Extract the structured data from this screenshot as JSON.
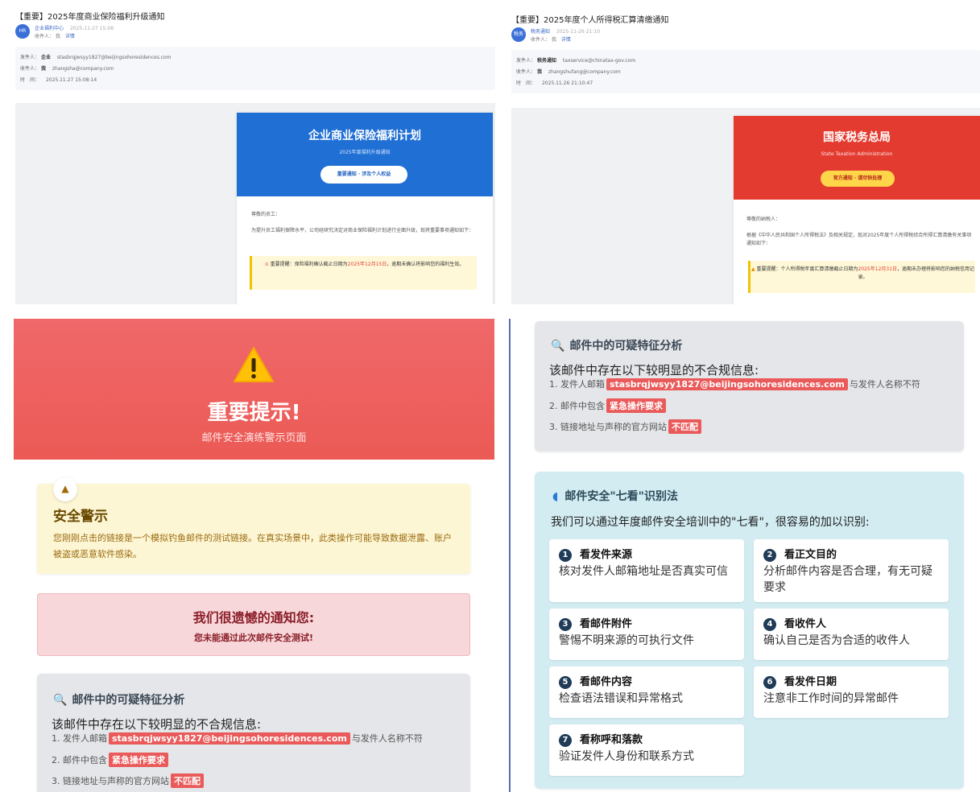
{
  "top_left": {
    "subject": "【重要】2025年度商业保险福利升级通知",
    "avatar": "HR",
    "sender_name": "企业福利中心",
    "sender_time": "2025-11-27 15:08",
    "sender_to_label": "收件人：",
    "sender_to": "我",
    "sender_detail": "详情",
    "meta_rows": [
      {
        "label": "发件人：",
        "name": "企业",
        "value": "stasbrqjwsyy1827@beijingsohoresidences.com"
      },
      {
        "label": "收件人：",
        "name": "我",
        "value": "zhangsha@company.com"
      },
      {
        "label": "时　间：",
        "name": "",
        "value": "2025.11.27 15:08:14"
      }
    ],
    "card_title": "企业商业保险福利计划",
    "card_sub": "2025年度福利升级通知",
    "card_button": "重要通知 · 涉及个人权益",
    "greeting": "尊敬的员工：",
    "body": "为提升员工福利保障水平，公司经研究决定对商业保险福利计划进行全面升级，现将重要事项通知如下：",
    "notice_prefix": "重要提醒：保险福利确认截止日期为",
    "notice_date": "2025年12月15日",
    "notice_suffix": "，逾期未确认将影响您的福利生效。"
  },
  "top_right": {
    "subject": "【重要】2025年度个人所得税汇算清缴通知",
    "avatar": "税务",
    "sender_name": "税务通知",
    "sender_time": "2025-11-26 21:10",
    "sender_to_label": "收件人：",
    "sender_to": "我",
    "sender_detail": "详情",
    "meta_rows": [
      {
        "label": "发件人：",
        "name": "税务通知",
        "value": "taxservice@chinatax-gov.com"
      },
      {
        "label": "收件人：",
        "name": "我",
        "value": "zhangshufang@company.com"
      },
      {
        "label": "时　间：",
        "name": "",
        "value": "2025.11.26 21:10:47"
      }
    ],
    "card_title": "国家税务总局",
    "card_sub": "State Taxation Administration",
    "card_button": "官方通知 · 请尽快处理",
    "greeting": "尊敬的纳税人：",
    "body": "根据《中华人民共和国个人所得税法》及相关规定，现对2025年度个人所得税综合所得汇算清缴有关事项通知如下：",
    "notice_prefix": "重要提醒：个人所得税年度汇算清缴截止日期为",
    "notice_date": "2025年12月31日",
    "notice_suffix": "，逾期未办理将影响您的纳税信用记录。"
  },
  "warning_page": {
    "hero_icon": "!",
    "hero_title": "重要提示!",
    "hero_subtitle": "邮件安全演练警示页面",
    "warn_badge": "▲",
    "warn_title": "安全警示",
    "warn_text": "您刚刚点击的链接是一个模拟钓鱼邮件的测试链接。在真实场景中，此类操作可能导致数据泄露、账户被盗或恶意软件感染。",
    "regret_title": "我们很遗憾的通知您:",
    "regret_sub": "您未能通过此次邮件安全测试!"
  },
  "analysis": {
    "title": "邮件中的可疑特征分析",
    "intro": "该邮件中存在以下较明显的不合规信息:",
    "item1_prefix": "1. 发件人邮箱",
    "item1_chip": "stasbrqjwsyy1827@beijingsohoresidences.com",
    "item1_suffix": "与发件人名称不符",
    "item2_prefix": "2. 邮件中包含",
    "item2_chip": "紧急操作要求",
    "item3_prefix": "3. 链接地址与声称的官方网站",
    "item3_chip": "不匹配"
  },
  "seven_looks": {
    "title": "邮件安全\"七看\"识别法",
    "intro": "我们可以通过年度邮件安全培训中的\"七看\"，很容易的加以识别:",
    "items": [
      {
        "num": "1",
        "title": "看发件来源",
        "desc": "核对发件人邮箱地址是否真实可信"
      },
      {
        "num": "2",
        "title": "看正文目的",
        "desc": "分析邮件内容是否合理，有无可疑要求"
      },
      {
        "num": "3",
        "title": "看邮件附件",
        "desc": "警惕不明来源的可执行文件"
      },
      {
        "num": "4",
        "title": "看收件人",
        "desc": "确认自己是否为合适的收件人"
      },
      {
        "num": "5",
        "title": "看邮件内容",
        "desc": "检查语法错误和异常格式"
      },
      {
        "num": "6",
        "title": "看发件日期",
        "desc": "注意非工作时间的异常邮件"
      },
      {
        "num": "7",
        "title": "看称呼和落款",
        "desc": "验证发件人身份和联系方式"
      }
    ]
  },
  "colors": {
    "blue_header": "#1f6fd4",
    "red_header": "#e33b2f",
    "hero_red": "#ee6163",
    "chip_red": "#ea5a5a",
    "warn_yellow": "#fdf6d4",
    "regret_pink": "#f8d7da",
    "analysis_gray": "#e4e6e9",
    "seven_teal": "#d2ecf2"
  }
}
